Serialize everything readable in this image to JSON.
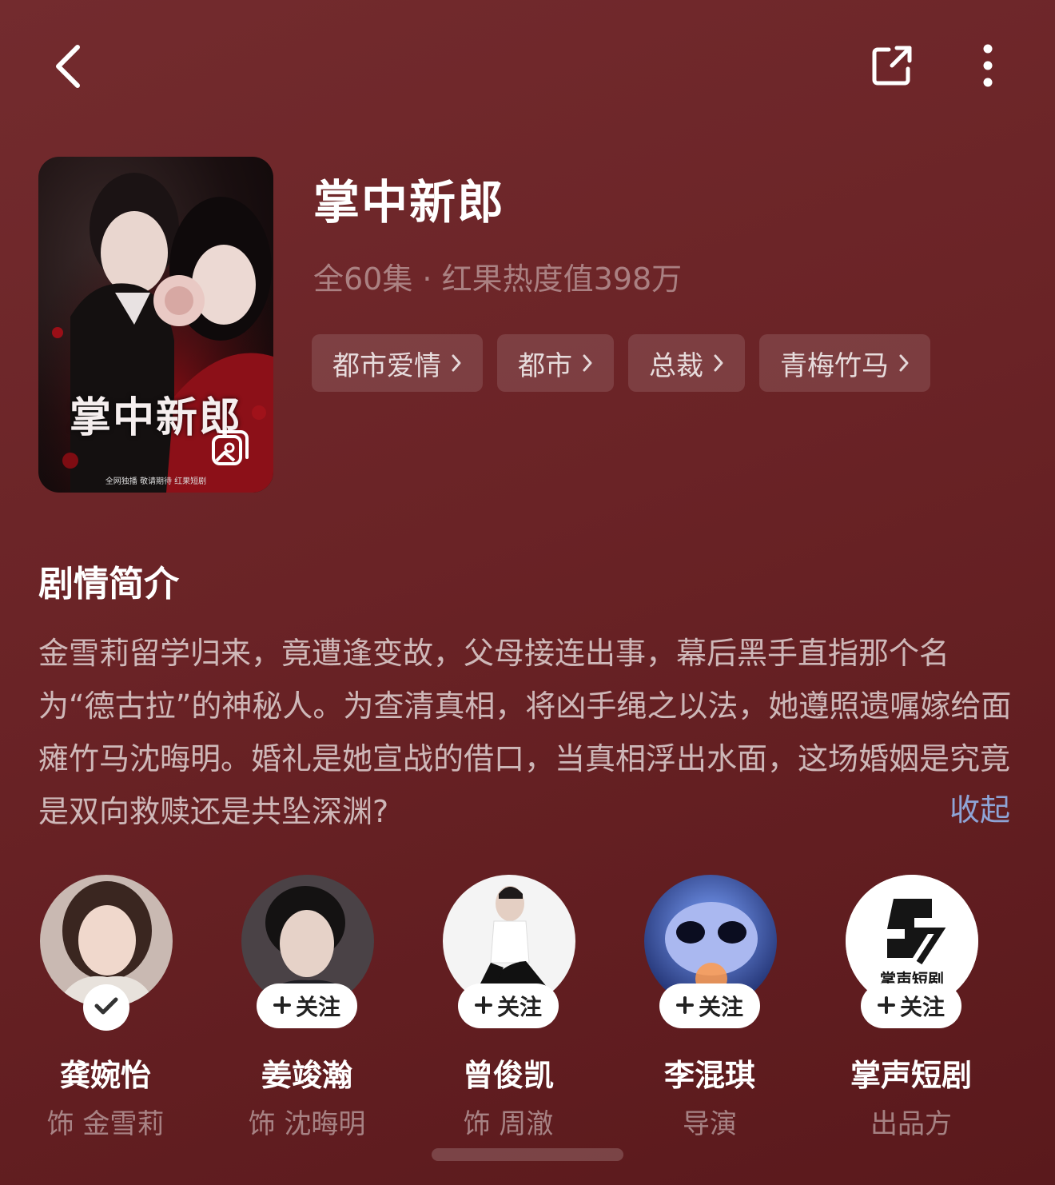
{
  "drama": {
    "title": "掌中新郎",
    "meta": "全60集 · 红果热度值398万",
    "poster_title": "掌中新郎",
    "poster_footer": "全网独播 敬请期待  红果短剧",
    "tags": [
      {
        "label": "都市爱情"
      },
      {
        "label": "都市"
      },
      {
        "label": "总裁"
      },
      {
        "label": "青梅竹马"
      }
    ]
  },
  "synopsis": {
    "heading": "剧情简介",
    "text": "金雪莉留学归来，竟遭逢变故，父母接连出事，幕后黑手直指那个名为“德古拉”的神秘人。为查清真相，将凶手绳之以法，她遵照遗嘱嫁给面瘫竹马沈晦明。婚礼是她宣战的借口，当真相浮出水面，这场婚姻是究竟是双向救赎还是共坠深渊?",
    "collapse_label": "收起"
  },
  "cast": [
    {
      "name": "龚婉怡",
      "role": "饰 金雪莉",
      "followed": true,
      "follow_label": ""
    },
    {
      "name": "姜竣瀚",
      "role": "饰 沈晦明",
      "followed": false,
      "follow_label": "关注"
    },
    {
      "name": "曾俊凯",
      "role": "饰 周澈",
      "followed": false,
      "follow_label": "关注"
    },
    {
      "name": "李混琪",
      "role": "导演",
      "followed": false,
      "follow_label": "关注"
    },
    {
      "name": "掌声短剧",
      "role": "出品方",
      "followed": false,
      "follow_label": "关注",
      "logo_text": "掌声短剧"
    }
  ],
  "icons": {
    "back": "chevron-left-icon",
    "share": "share-icon",
    "more": "more-vertical-icon",
    "gallery": "gallery-icon"
  },
  "colors": {
    "background": "#6a2326",
    "link": "#8ea4d6"
  }
}
